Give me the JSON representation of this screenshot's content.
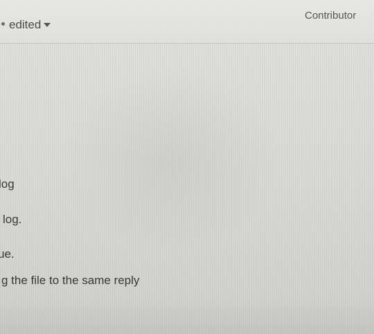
{
  "comment": {
    "edited_label": "edited",
    "author_badge": "Contributor"
  },
  "body_lines": [
    "log",
    "log.",
    "ue.",
    "g the file to the same reply"
  ],
  "icons": {
    "separator": "dot-separator-icon",
    "edit_menu": "caret-down-icon"
  }
}
